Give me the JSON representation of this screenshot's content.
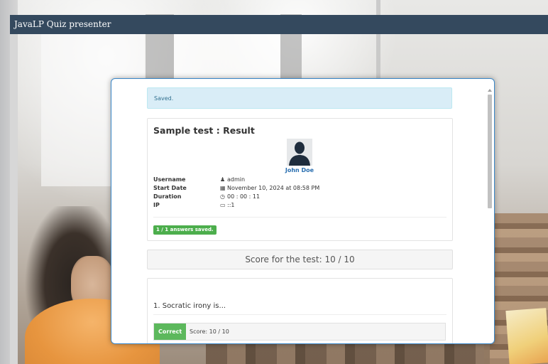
{
  "app": {
    "title": "JavaLP Quiz presenter"
  },
  "alert": {
    "text": "Saved."
  },
  "result": {
    "title": "Sample test : Result",
    "user_display_name": "John Doe",
    "fields": [
      {
        "label": "Username",
        "icon": "user-icon",
        "glyph": "♟",
        "value": "admin"
      },
      {
        "label": "Start Date",
        "icon": "calendar-icon",
        "glyph": "▦",
        "value": "November 10, 2024 at 08:58 PM"
      },
      {
        "label": "Duration",
        "icon": "clock-icon",
        "glyph": "◷",
        "value": "00 : 00 : 11"
      },
      {
        "label": "IP",
        "icon": "laptop-icon",
        "glyph": "▭",
        "value": "::1"
      }
    ],
    "answers_badge": "1 / 1 answers saved."
  },
  "score": {
    "text": "Score for the test: 10 / 10"
  },
  "questions": [
    {
      "text": "1. Socratic irony is...",
      "status": "Correct",
      "score_text": "Score: 10 / 10"
    }
  ],
  "colors": {
    "navbar": "#34495e",
    "alert_bg": "#d9edf7",
    "success": "#5cb85c",
    "link": "#2a6fb0",
    "modal_border": "#3a87c8"
  }
}
